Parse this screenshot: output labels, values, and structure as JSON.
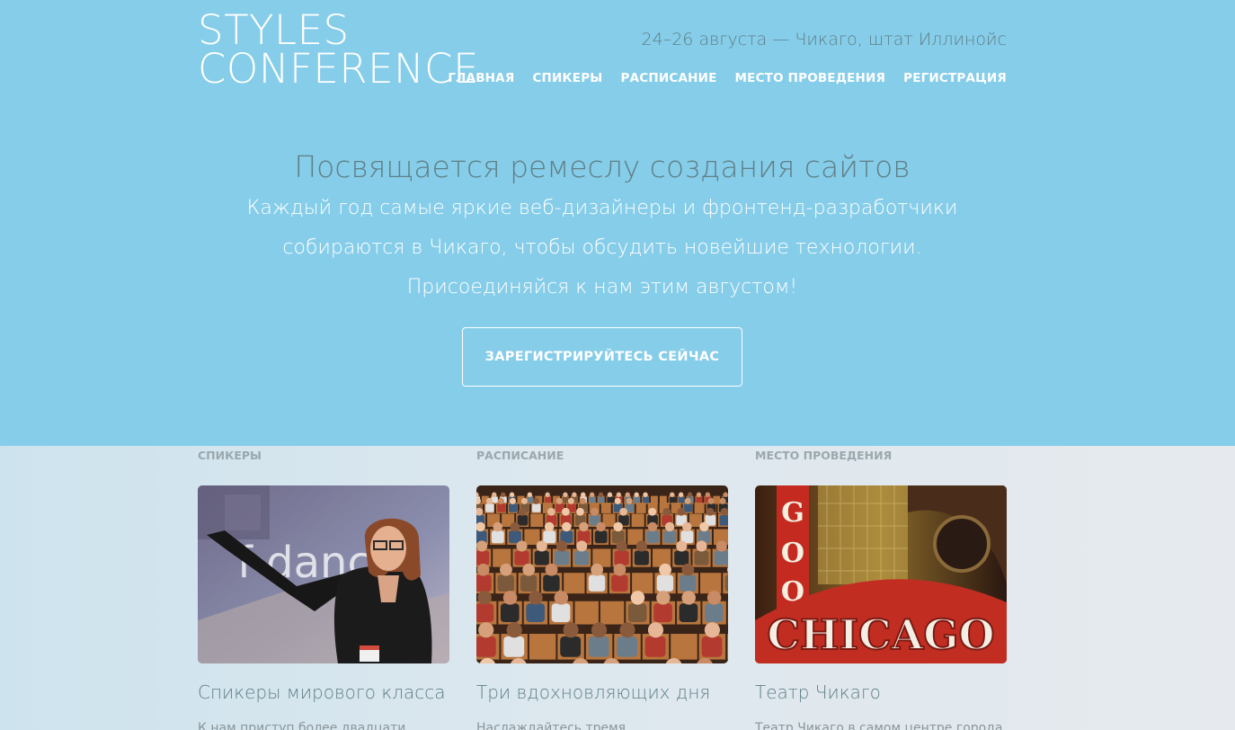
{
  "header": {
    "logo_line1": "STYLES",
    "logo_line2": "CONFERENCE",
    "event_info": "24–26 августа — Чикаго, штат Иллинойс",
    "nav": [
      "ГЛАВНАЯ",
      "СПИКЕРЫ",
      "РАСПИСАНИЕ",
      "МЕСТО ПРОВЕДЕНИЯ",
      "РЕГИСТРАЦИЯ"
    ]
  },
  "hero": {
    "headline": "Посвящается ремеслу создания сайтов",
    "lead_line1": "Каждый год самые яркие веб-дизайнеры и фронтенд-разработчики",
    "lead_line2": "собираются в Чикаго, чтобы обсудить новейшие технологии.",
    "lead_line3": "Присоединяйся к нам этим августом!",
    "cta_label": "ЗАРЕГИСТРИРУЙТЕСЬ СЕЙЧАС"
  },
  "features": [
    {
      "tag": "СПИКЕРЫ",
      "title": "Спикеры мирового класса",
      "text": "К нам приступ более двадцати",
      "photo_word": "f dance"
    },
    {
      "tag": "РАСПИСАНИЕ",
      "title": "Три вдохновляющих дня",
      "text": "Наслаждайтесь тремя"
    },
    {
      "tag": "МЕСТО ПРОВЕДЕНИЯ",
      "title": "Театр Чикаго",
      "text": "Театр Чикаго в самом центре города",
      "photo_sign": "CHICAGO",
      "photo_vertical_sign": "GOO"
    }
  ],
  "colors": {
    "hero_background": "#86cde9",
    "accent_text": "#5f7f86",
    "lower_background": "#e6eaee"
  }
}
